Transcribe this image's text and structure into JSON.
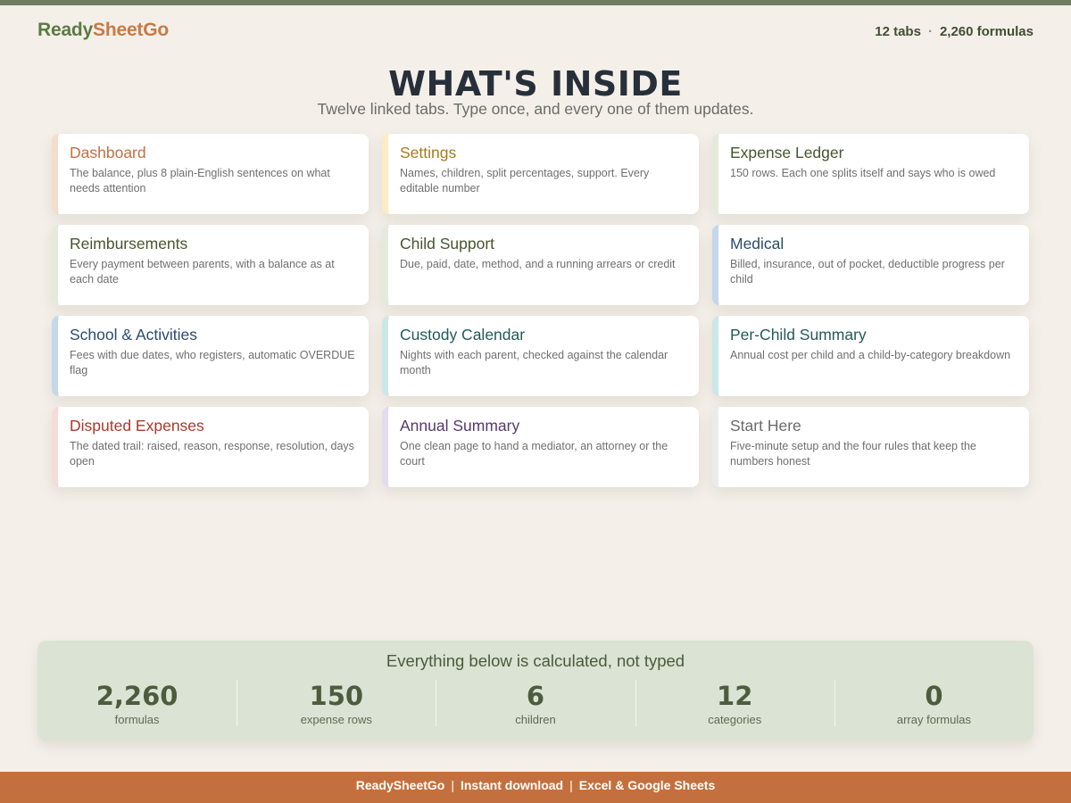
{
  "header": {
    "brand_part1": "Ready",
    "brand_part2": "SheetGo",
    "tabs_count": "12 tabs",
    "separator": "·",
    "formulas_count": "2,260 formulas"
  },
  "title": "WHAT'S INSIDE",
  "subtitle": "Twelve linked tabs. Type once, and every one of them updates.",
  "cards": [
    {
      "title": "Dashboard",
      "desc": "The balance, plus 8 plain-English sentences on what needs attention"
    },
    {
      "title": "Settings",
      "desc": "Names, children, split percentages, support. Every editable number"
    },
    {
      "title": "Expense Ledger",
      "desc": "150 rows. Each one splits itself and says who is owed"
    },
    {
      "title": "Reimbursements",
      "desc": "Every payment between parents, with a balance as at each date"
    },
    {
      "title": "Child Support",
      "desc": "Due, paid, date, method, and a running arrears or credit"
    },
    {
      "title": "Medical",
      "desc": "Billed, insurance, out of pocket, deductible progress per child"
    },
    {
      "title": "School & Activities",
      "desc": "Fees with due dates, who registers, automatic OVERDUE flag"
    },
    {
      "title": "Custody Calendar",
      "desc": "Nights with each parent, checked against the calendar month"
    },
    {
      "title": "Per-Child Summary",
      "desc": "Annual cost per child and a child-by-category breakdown"
    },
    {
      "title": "Disputed Expenses",
      "desc": "The dated trail: raised, reason, response, resolution, days open"
    },
    {
      "title": "Annual Summary",
      "desc": "One clean page to hand a mediator, an attorney or the court"
    },
    {
      "title": "Start Here",
      "desc": "Five-minute setup and the four rules that keep the numbers honest"
    }
  ],
  "stats": {
    "title": "Everything below is calculated, not typed",
    "items": [
      {
        "value": "2,260",
        "label": "formulas"
      },
      {
        "value": "150",
        "label": "expense rows"
      },
      {
        "value": "6",
        "label": "children"
      },
      {
        "value": "12",
        "label": "categories"
      },
      {
        "value": "0",
        "label": "array formulas"
      }
    ]
  },
  "footer": {
    "brand": "ReadySheetGo",
    "sep": "|",
    "item1": "Instant download",
    "item2": "Excel & Google Sheets"
  },
  "colors": {
    "accent_green": "#6f7d60",
    "accent_orange": "#c4703e",
    "background": "#f4f0e9",
    "stats_panel": "#dbe3d4"
  }
}
